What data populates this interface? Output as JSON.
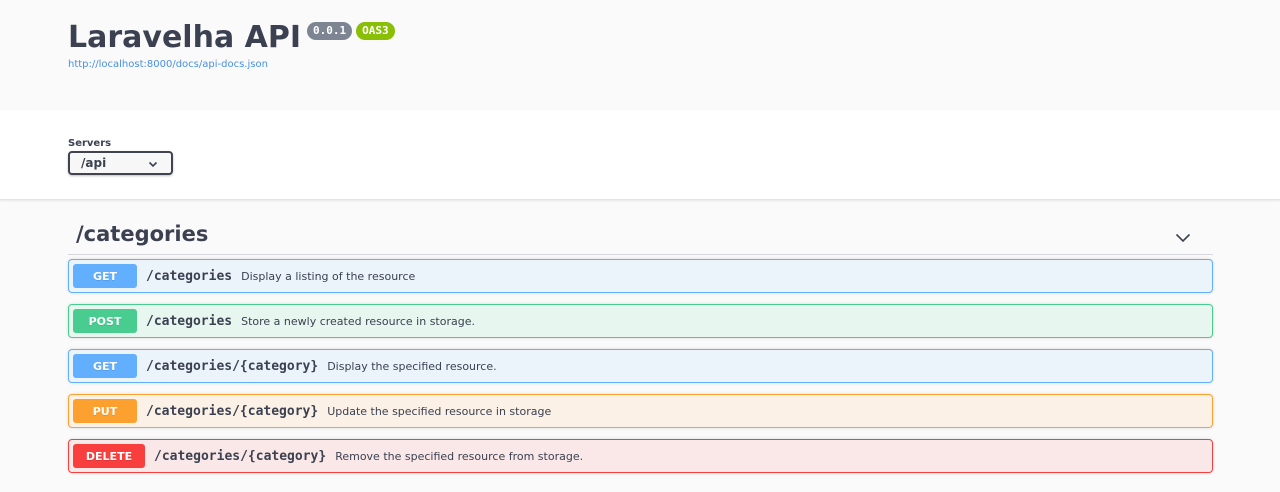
{
  "info": {
    "title": "Laravelha API",
    "version": "0.0.1",
    "oas": "OAS3",
    "spec_url": "http://localhost:8000/docs/api-docs.json"
  },
  "servers": {
    "label": "Servers",
    "selected": "/api"
  },
  "tag": {
    "name": "/categories",
    "operations": [
      {
        "method": "GET",
        "path": "/categories",
        "summary": "Display a listing of the resource"
      },
      {
        "method": "POST",
        "path": "/categories",
        "summary": "Store a newly created resource in storage."
      },
      {
        "method": "GET",
        "path": "/categories/{category}",
        "summary": "Display the specified resource."
      },
      {
        "method": "PUT",
        "path": "/categories/{category}",
        "summary": "Update the specified resource in storage"
      },
      {
        "method": "DELETE",
        "path": "/categories/{category}",
        "summary": "Remove the specified resource from storage."
      }
    ]
  },
  "icons": {
    "servers_dropdown": "chevron-down-icon",
    "tag_toggle": "chevron-down-icon"
  },
  "colors": {
    "get": "#61affe",
    "post": "#49cc90",
    "put": "#fca130",
    "delete": "#f93e3e",
    "oas_badge": "#89bf04",
    "version_badge": "#7d8492",
    "link": "#4990e2"
  }
}
